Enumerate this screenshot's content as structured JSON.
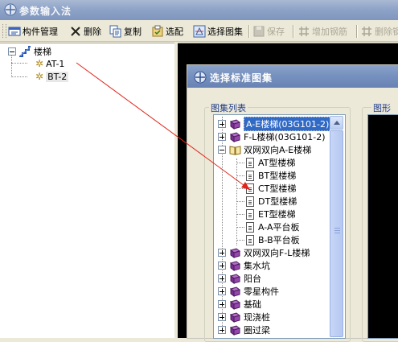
{
  "window": {
    "title": "参数输入法",
    "icon": "app-logo-icon"
  },
  "toolbar": {
    "items": [
      {
        "label": "构件管理",
        "icon": "component-manage-icon",
        "enabled": true
      },
      {
        "label": "删除",
        "icon": "delete-x-icon",
        "enabled": true
      },
      {
        "label": "复制",
        "icon": "copy-icon",
        "enabled": true
      },
      {
        "label": "选配",
        "icon": "select-config-icon",
        "enabled": true
      },
      {
        "label": "选择图集",
        "icon": "atlas-select-icon",
        "enabled": true
      },
      {
        "label": "保存",
        "icon": "save-icon",
        "enabled": false
      },
      {
        "label": "增加钢筋",
        "icon": "add-rebar-icon",
        "enabled": false
      },
      {
        "label": "删除钢",
        "icon": "delete-rebar-icon",
        "enabled": false
      }
    ]
  },
  "left_tree": {
    "root": {
      "label": "楼梯",
      "expanded": true,
      "icon": "stairs-icon"
    },
    "children": [
      {
        "label": "AT-1",
        "icon": "gear-icon"
      },
      {
        "label": "BT-2",
        "icon": "gear-icon",
        "selected": true
      }
    ]
  },
  "dialog": {
    "title": "选择标准图集",
    "icon": "dialog-app-icon",
    "list_group_label": "图集列表",
    "preview_group_label": "图形显",
    "items": [
      {
        "label": "A-E楼梯(03G101-2)",
        "level": 0,
        "type": "book",
        "expander": "plus",
        "selected": true
      },
      {
        "label": "F-L楼梯(03G101-2)",
        "level": 0,
        "type": "book",
        "expander": "plus"
      },
      {
        "label": "双网双向A-E楼梯",
        "level": 0,
        "type": "open-book",
        "expander": "minus"
      },
      {
        "label": "AT型楼梯",
        "level": 1,
        "type": "doc"
      },
      {
        "label": "BT型楼梯",
        "level": 1,
        "type": "doc"
      },
      {
        "label": "CT型楼梯",
        "level": 1,
        "type": "doc"
      },
      {
        "label": "DT型楼梯",
        "level": 1,
        "type": "doc"
      },
      {
        "label": "ET型楼梯",
        "level": 1,
        "type": "doc"
      },
      {
        "label": "A-A平台板",
        "level": 1,
        "type": "doc"
      },
      {
        "label": "B-B平台板",
        "level": 1,
        "type": "doc"
      },
      {
        "label": "双网双向F-L楼梯",
        "level": 0,
        "type": "book",
        "expander": "plus"
      },
      {
        "label": "集水坑",
        "level": 0,
        "type": "book",
        "expander": "plus"
      },
      {
        "label": "阳台",
        "level": 0,
        "type": "book",
        "expander": "plus"
      },
      {
        "label": "零星构件",
        "level": 0,
        "type": "book",
        "expander": "plus"
      },
      {
        "label": "基础",
        "level": 0,
        "type": "book",
        "expander": "plus"
      },
      {
        "label": "现浇桩",
        "level": 0,
        "type": "book",
        "expander": "plus"
      },
      {
        "label": "圈过梁",
        "level": 0,
        "type": "book",
        "expander": "plus"
      }
    ]
  },
  "colors": {
    "arrow": "#e0241b",
    "selection": "#316ac5"
  }
}
